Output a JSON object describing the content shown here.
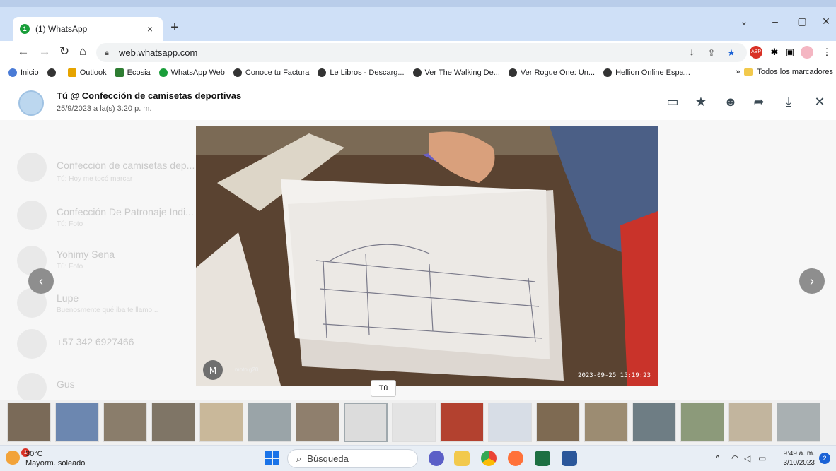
{
  "browser": {
    "tab_title": "(1) WhatsApp",
    "tab_favicon_badge": "1",
    "tab_close": "×",
    "new_tab": "+",
    "url": "web.whatsapp.com",
    "window_controls": {
      "dropdown": "⌄",
      "minimize": "–",
      "maximize": "▢",
      "close": "✕"
    }
  },
  "bookmarks": {
    "items": [
      {
        "label": "Inicio",
        "color": "#4a7bd6"
      },
      {
        "label": "",
        "color": "#333333"
      },
      {
        "label": "Outlook",
        "color": "#e6a400"
      },
      {
        "label": "Ecosia",
        "color": "#2e7d32"
      },
      {
        "label": "WhatsApp Web",
        "color": "#1a9e3a"
      },
      {
        "label": "Conoce tu Factura",
        "color": "#333333"
      },
      {
        "label": "Le Libros - Descarg...",
        "color": "#333333"
      },
      {
        "label": "Ver The Walking De...",
        "color": "#333333"
      },
      {
        "label": "Ver Rogue One: Un...",
        "color": "#333333"
      },
      {
        "label": "Hellion Online Espa...",
        "color": "#333333"
      }
    ],
    "overflow": "»",
    "all_bookmarks": "Todos los marcadores"
  },
  "media_viewer": {
    "sender_title": "Tú @ Confección de camisetas deportivas",
    "date": "25/9/2023 a la(s) 3:20 p. m.",
    "actions": [
      "reply-icon",
      "star-icon",
      "emoji-icon",
      "forward-icon",
      "download-icon",
      "close-icon"
    ],
    "photo_watermark_brand": "moto g20",
    "photo_timestamp": "2023-09-25 15:19:23",
    "prev_arrow": "‹",
    "next_arrow": "›",
    "tooltip": "Tú"
  },
  "background_chats": [
    {
      "name": "Confección de camisetas dep...",
      "preview": "Tú: Hoy me tocó marcar"
    },
    {
      "name": "Confección De Patronaje Indi...",
      "preview": "Tú: Foto"
    },
    {
      "name": "Yohimy Sena",
      "preview": "Tú: Foto"
    },
    {
      "name": "Lupe",
      "preview": "Buenosmente qué iba te llamo..."
    },
    {
      "name": "+57 342 6927466",
      "preview": ""
    },
    {
      "name": "Gus",
      "preview": ""
    }
  ],
  "thumbnails": {
    "count": 17,
    "selected_index": 7,
    "colors": [
      "#7a6a58",
      "#6c87b0",
      "#8a7d6b",
      "#7f7566",
      "#c9b89a",
      "#9aa4a8",
      "#8f7f6d",
      "#dcdcdc",
      "#e3e3e3",
      "#b3412f",
      "#d7dde6",
      "#7e6a52",
      "#9c8c72",
      "#6e7d84",
      "#8c9a7a",
      "#c2b59e",
      "#a9b0b2"
    ]
  },
  "taskbar": {
    "weather_temp": "30°C",
    "weather_desc": "Mayorm. soleado",
    "weather_badge": "1",
    "search_placeholder": "Búsqueda",
    "time": "9:49 a. m.",
    "date": "3/10/2023",
    "notifications": "2",
    "tray_caret": "^"
  }
}
